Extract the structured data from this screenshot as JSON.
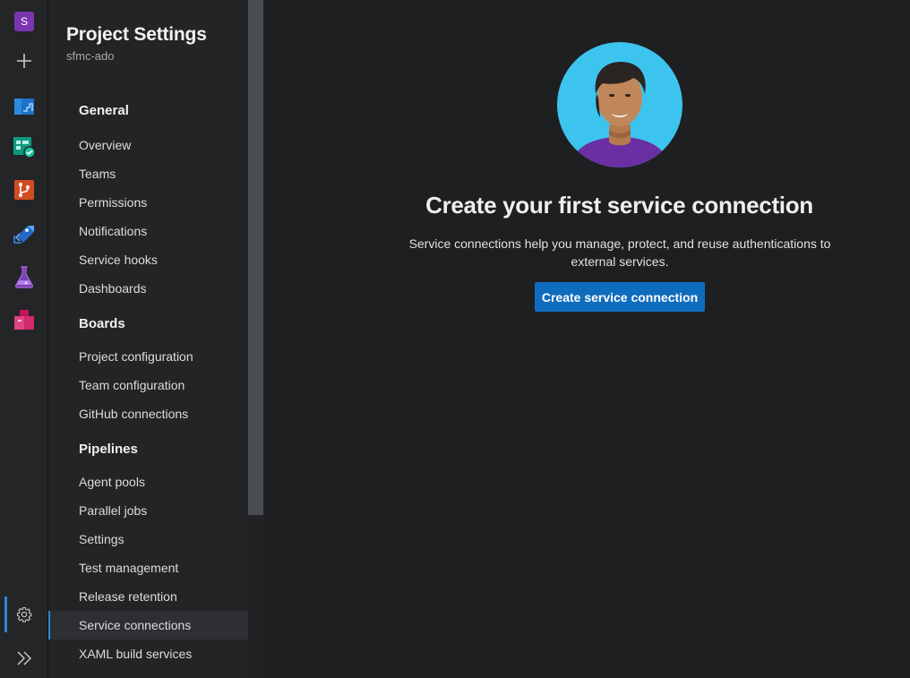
{
  "org": {
    "initial": "S"
  },
  "rail": {
    "items": [
      {
        "name": "organization-avatar"
      },
      {
        "name": "new-icon"
      },
      {
        "name": "overview-icon"
      },
      {
        "name": "boards-icon"
      },
      {
        "name": "repos-icon"
      },
      {
        "name": "pipelines-icon"
      },
      {
        "name": "test-plans-icon"
      },
      {
        "name": "artifacts-icon"
      }
    ],
    "settings_icon": "gear-icon",
    "expand_icon": "double-chevron-right-icon"
  },
  "nav": {
    "title": "Project Settings",
    "project": "sfmc-ado",
    "sections": [
      {
        "label": "General",
        "items": [
          "Overview",
          "Teams",
          "Permissions",
          "Notifications",
          "Service hooks",
          "Dashboards"
        ]
      },
      {
        "label": "Boards",
        "items": [
          "Project configuration",
          "Team configuration",
          "GitHub connections"
        ]
      },
      {
        "label": "Pipelines",
        "items": [
          "Agent pools",
          "Parallel jobs",
          "Settings",
          "Test management",
          "Release retention",
          "Service connections",
          "XAML build services"
        ]
      }
    ],
    "selected": "Service connections"
  },
  "main": {
    "illustration": "person-avatar-illustration",
    "headline": "Create your first service connection",
    "description": "Service connections help you manage, protect, and reuse authentications to external services.",
    "button_label": "Create service connection"
  },
  "colors": {
    "accent": "#0f6cbd",
    "selection_bar": "#2b88d8",
    "background": "#1e1f21"
  }
}
